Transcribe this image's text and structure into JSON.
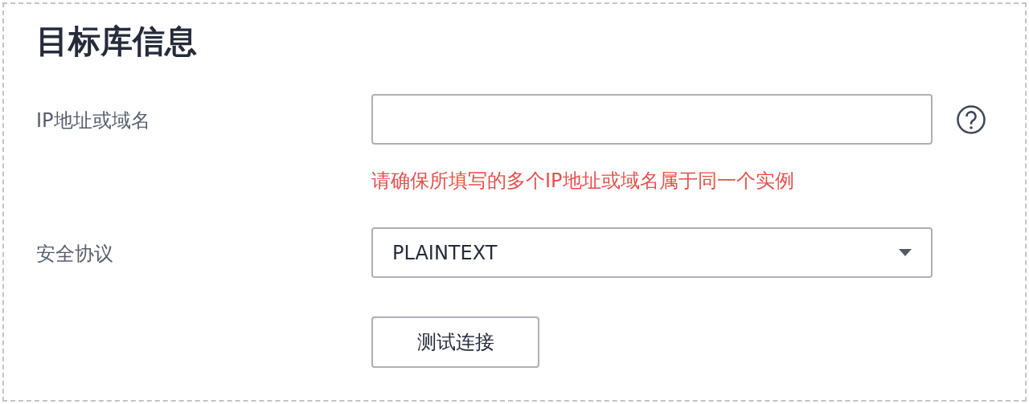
{
  "section": {
    "title": "目标库信息"
  },
  "fields": [
    {
      "kind": "input",
      "label": "IP地址或域名",
      "help": true,
      "error": "请确保所填写的多个IP地址或域名属于同一个实例"
    },
    {
      "kind": "select",
      "label": "安全协议",
      "value": "PLAINTEXT",
      "help": false
    }
  ],
  "buttons": [
    {
      "label": "测试连接"
    }
  ]
}
